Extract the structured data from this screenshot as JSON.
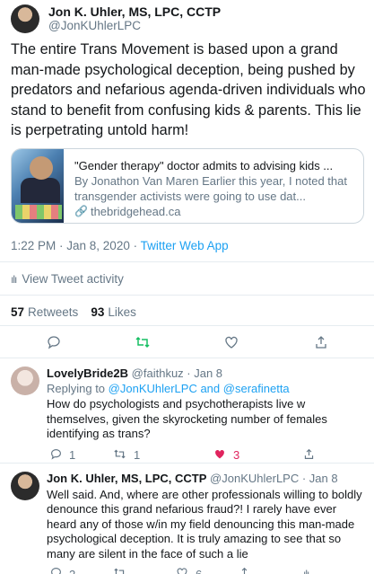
{
  "tweet": {
    "author": {
      "name": "Jon K. Uhler, MS, LPC, CCTP",
      "handle": "@JonKUhlerLPC",
      "avatar_icon": "avatar-photo"
    },
    "text": "The entire Trans Movement is based upon a grand man-made psychological deception, being pushed by predators and nefarious agenda-driven individuals who stand to benefit from confusing kids & parents. This lie is perpetrating untold harm!",
    "card": {
      "title": "\"Gender therapy\" doctor admits to advising kids ...",
      "description": "By Jonathon Van Maren Earlier this year, I noted that transgender activists were going to use dat...",
      "domain": "thebridgehead.ca",
      "link_icon": "link-icon"
    },
    "time": "1:22 PM · Jan 8, 2020 · ",
    "source": "Twitter Web App",
    "activity_label": "View Tweet activity",
    "stats": {
      "retweets_count": "57",
      "retweets_label": "Retweets",
      "likes_count": "93",
      "likes_label": "Likes"
    },
    "actions": [
      "reply-icon",
      "retweet-icon",
      "like-icon",
      "share-icon"
    ],
    "colors": {
      "retweet_active": "#17bf63",
      "link": "#1da1f2",
      "like_active": "#e0245e"
    }
  },
  "replies": [
    {
      "name": "LovelyBride2B",
      "handle": "@faithkuz",
      "date": "· Jan 8",
      "replying_prefix": "Replying to ",
      "mention1": "@JonKUhlerLPC",
      "and": " and ",
      "mention2": "@serafinetta",
      "text": "How do psychologists and psychotherapists live w themselves, given the skyrocketing number of females identifying as trans?",
      "reply_count": "1",
      "retweet_count": "1",
      "like_count": "3"
    },
    {
      "name": "Jon K. Uhler, MS, LPC, CCTP",
      "handle": "@JonKUhlerLPC",
      "date": "· Jan 8",
      "text": "Well said. And, where are other professionals willing to boldly denounce this grand nefarious fraud?! I rarely have ever heard any of those w/in my field denouncing this man-made psychological deception. It is truly amazing to see that so many are silent in the face of such a lie",
      "reply_count": "2",
      "retweet_count": "",
      "like_count": "6"
    }
  ]
}
